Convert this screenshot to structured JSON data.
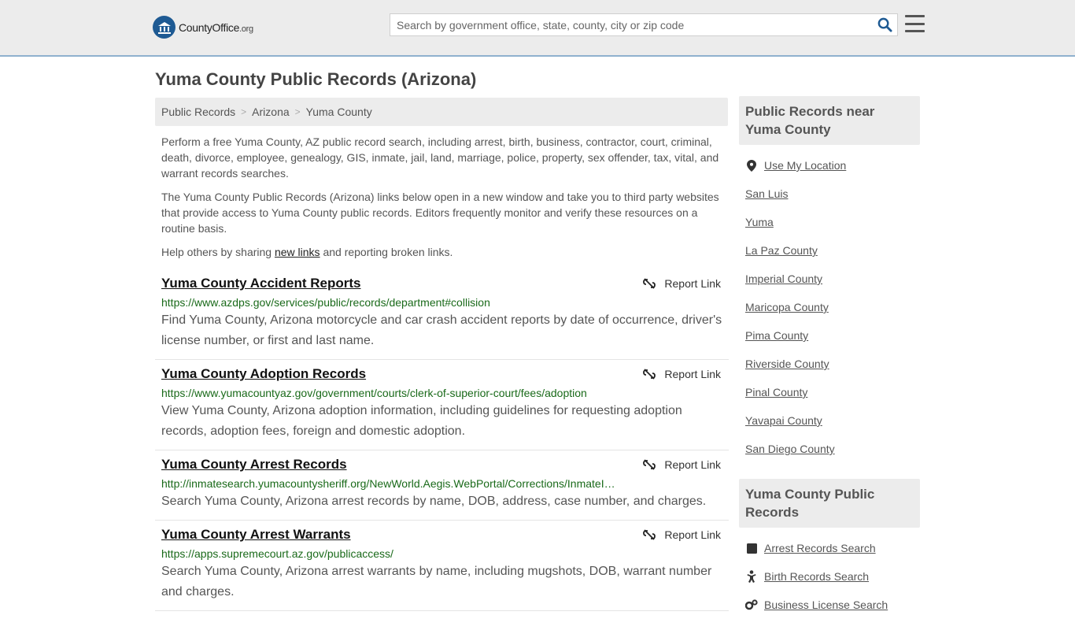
{
  "header": {
    "logo_name": "CountyOffice",
    "logo_tld": ".org",
    "search_placeholder": "Search by government office, state, county, city or zip code",
    "icons": {
      "search": "search-icon",
      "menu": "hamburger-menu-icon"
    },
    "accent_color": "#1e5a93"
  },
  "page": {
    "title": "Yuma County Public Records (Arizona)",
    "breadcrumb": [
      "Public Records",
      "Arizona",
      "Yuma County"
    ],
    "intro_1": "Perform a free Yuma County, AZ public record search, including arrest, birth, business, contractor, court, criminal, death, divorce, employee, genealogy, GIS, inmate, jail, land, marriage, police, property, sex offender, tax, vital, and warrant records searches.",
    "intro_2": "The Yuma County Public Records (Arizona) links below open in a new window and take you to third party websites that provide access to Yuma County public records. Editors frequently monitor and verify these resources on a routine basis.",
    "help_before": "Help others by sharing ",
    "help_link": "new links",
    "help_after": " and reporting broken links."
  },
  "results": [
    {
      "title": "Yuma County Accident Reports",
      "url": "https://www.azdps.gov/services/public/records/department#collision",
      "desc": "Find Yuma County, Arizona motorcycle and car crash accident reports by date of occurrence, driver's license number, or first and last name.",
      "report": "Report Link"
    },
    {
      "title": "Yuma County Adoption Records",
      "url": "https://www.yumacountyaz.gov/government/courts/clerk-of-superior-court/fees/adoption",
      "desc": "View Yuma County, Arizona adoption information, including guidelines for requesting adoption records, adoption fees, foreign and domestic adoption.",
      "report": "Report Link"
    },
    {
      "title": "Yuma County Arrest Records",
      "url": "http://inmatesearch.yumacountysheriff.org/NewWorld.Aegis.WebPortal/Corrections/InmateInquiry.aspx",
      "desc": "Search Yuma County, Arizona arrest records by name, DOB, address, case number, and charges.",
      "report": "Report Link"
    },
    {
      "title": "Yuma County Arrest Warrants",
      "url": "https://apps.supremecourt.az.gov/publicaccess/",
      "desc": "Search Yuma County, Arizona arrest warrants by name, including mugshots, DOB, warrant number and charges.",
      "report": "Report Link"
    }
  ],
  "sidebar": {
    "nearby_title": "Public Records near Yuma County",
    "use_location": "Use My Location",
    "nearby": [
      "San Luis",
      "Yuma",
      "La Paz County",
      "Imperial County",
      "Maricopa County",
      "Pima County",
      "Riverside County",
      "Pinal County",
      "Yavapai County",
      "San Diego County"
    ],
    "records_title": "Yuma County Public Records",
    "records": [
      {
        "label": "Arrest Records Search",
        "icon": "square-icon"
      },
      {
        "label": "Birth Records Search",
        "icon": "baby-icon"
      },
      {
        "label": "Business License Search",
        "icon": "gears-icon"
      }
    ]
  }
}
